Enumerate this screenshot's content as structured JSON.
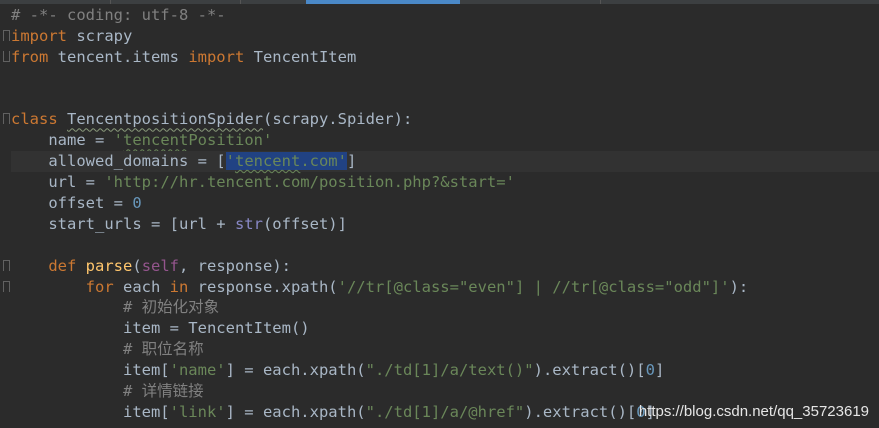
{
  "editor": {
    "lines": [
      {
        "t": "# -*- coding: utf-8 -*-"
      },
      {
        "t": "import scrapy"
      },
      {
        "t": "from tencent.items import TencentItem"
      },
      {
        "t": ""
      },
      {
        "t": ""
      },
      {
        "t": "class TencentpositionSpider(scrapy.Spider):"
      },
      {
        "t": "    name = 'tencentPosition'"
      },
      {
        "t": "    allowed_domains = ['tencent.com']"
      },
      {
        "t": "    url = 'http://hr.tencent.com/position.php?&start='"
      },
      {
        "t": "    offset = 0"
      },
      {
        "t": "    start_urls = [url + str(offset)]"
      },
      {
        "t": ""
      },
      {
        "t": "    def parse(self, response):"
      },
      {
        "t": "        for each in response.xpath('//tr[@class=\"even\"] | //tr[@class=\"odd\"]'):"
      },
      {
        "t": "            # 初始化对象"
      },
      {
        "t": "            item = TencentItem()"
      },
      {
        "t": "            # 职位名称"
      },
      {
        "t": "            item['name'] = each.xpath(\"./td[1]/a/text()\").extract()[0]"
      },
      {
        "t": "            # 详情链接"
      },
      {
        "t": "            item['link'] = each.xpath(\"./td[1]/a/@href\").extract()[0]"
      }
    ],
    "tokens": {
      "l0_comment": "# -*- coding: utf-8 -*-",
      "l1_kw": "import",
      "l1_rest": " scrapy",
      "l2_kw1": "from",
      "l2_mid": " tencent.items ",
      "l2_kw2": "import",
      "l2_rest": " TencentItem",
      "l5_kw": "class",
      "l5_name": "TencentpositionSpider",
      "l5_rest": "(scrapy.Spider):",
      "l6_a": "    name = ",
      "l6_q1": "'",
      "l6_s1": "tencent",
      "l6_s2": "Position",
      "l6_q2": "'",
      "l7_a": "    allowed_domains = [",
      "l7_sel_q1": "'",
      "l7_sel_s": "tencent",
      "l7_sel_rest": ".com'",
      "l7_b": "]",
      "l8_a": "    url = ",
      "l8_s": "'http://hr.tencent.com/position.php?&start='",
      "l9_a": "    offset = ",
      "l9_n": "0",
      "l10_a": "    start_urls = [url + ",
      "l10_b": "str",
      "l10_c": "(offset)]",
      "l12_ind": "    ",
      "l12_kw": "def",
      "l12_sp": " ",
      "l12_fn": "parse",
      "l12_p1": "(",
      "l12_self": "self",
      "l12_p2": ", response):",
      "l13_ind": "        ",
      "l13_kw1": "for",
      "l13_m1": " each ",
      "l13_kw2": "in",
      "l13_m2": " response.xpath(",
      "l13_s": "'//tr[@class=\"even\"] | //tr[@class=\"odd\"]'",
      "l13_e": "):",
      "l14_c": "            # 初始化对象",
      "l15_a": "            item = TencentItem()",
      "l16_c": "            # 职位名称",
      "l17_a": "            item[",
      "l17_s1": "'name'",
      "l17_b": "] = each.xpath(",
      "l17_s2": "\"./td[1]/a/text()\"",
      "l17_c": ").extract()[",
      "l17_n": "0",
      "l17_d": "]",
      "l18_c": "            # 详情链接",
      "l19_a": "            item[",
      "l19_s1": "'link'",
      "l19_b": "] = each.xpath(",
      "l19_s2": "\"./td[1]/a/@href\"",
      "l19_c": ").extract()[",
      "l19_n": "0",
      "l19_d": "]"
    }
  },
  "watermark": "https://blog.csdn.net/qq_35723619",
  "colors": {
    "background": "#2b2b2b",
    "keyword": "#cc7832",
    "string": "#6a8759",
    "number": "#6897bb",
    "comment": "#808080",
    "self": "#94558d",
    "function": "#ffc66d",
    "selection": "#214283"
  }
}
